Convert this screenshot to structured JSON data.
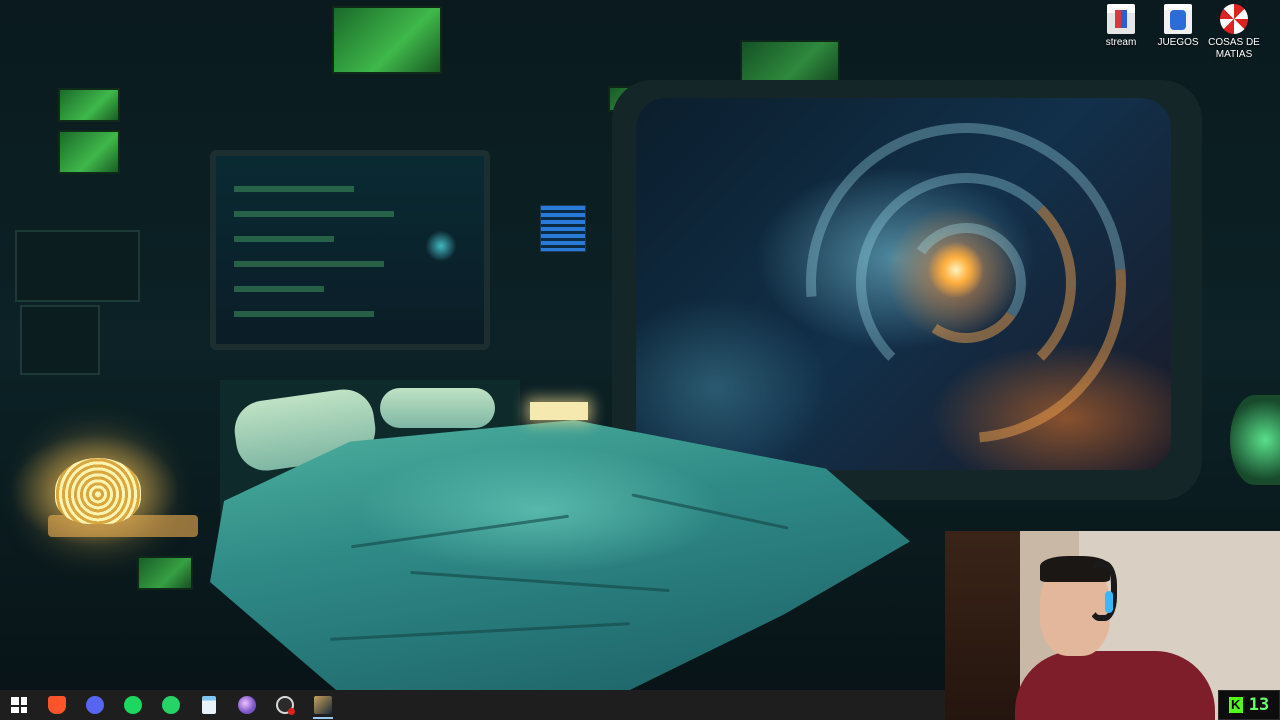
{
  "desktop": {
    "icons": [
      {
        "label": "stream",
        "icon": "stream-shortcut-icon"
      },
      {
        "label": "JUEGOS",
        "icon": "juegos-folder-icon"
      },
      {
        "label": "COSAS DE MATIAS",
        "icon": "umbrella-corp-icon"
      }
    ],
    "wallpaper": "sci-fi spaceship bedroom with galaxy window"
  },
  "taskbar": {
    "items": [
      {
        "name": "start",
        "icon": "windows-start-icon"
      },
      {
        "name": "brave",
        "icon": "brave-browser-icon"
      },
      {
        "name": "discord",
        "icon": "discord-icon"
      },
      {
        "name": "spotify",
        "icon": "spotify-icon"
      },
      {
        "name": "whatsapp",
        "icon": "whatsapp-icon"
      },
      {
        "name": "notepad",
        "icon": "notepad-icon"
      },
      {
        "name": "paint",
        "icon": "paint-icon"
      },
      {
        "name": "obs",
        "icon": "obs-studio-icon"
      },
      {
        "name": "league",
        "icon": "league-of-legends-icon"
      }
    ],
    "active_index": 8
  },
  "webcam": {
    "kick_logo": "K",
    "viewer_count": "13"
  },
  "colors": {
    "taskbar_bg": "#1e1e1e",
    "kick_green": "#53fc18",
    "accent_teal": "#2f8a86"
  }
}
